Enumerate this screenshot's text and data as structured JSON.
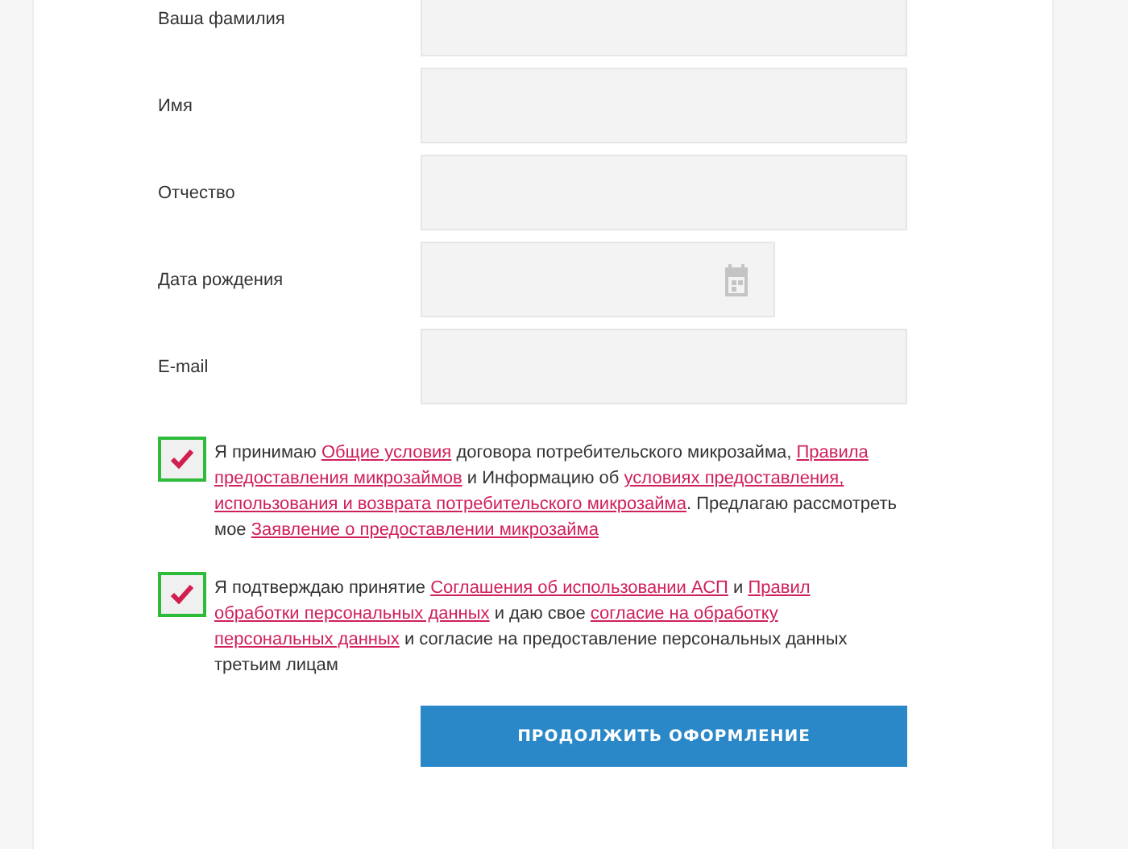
{
  "fields": [
    {
      "label": "Ваша фамилия",
      "kind": "text"
    },
    {
      "label": "Имя",
      "kind": "text"
    },
    {
      "label": "Отчество",
      "kind": "text"
    },
    {
      "label": "Дата рождения",
      "kind": "date"
    },
    {
      "label": "E-mail",
      "kind": "text"
    }
  ],
  "agreements": [
    {
      "checked": true,
      "parts": [
        {
          "text": "Я принимаю ",
          "kind": "text"
        },
        {
          "text": "Общие условия",
          "kind": "link"
        },
        {
          "text": " договора потребительского микрозайма, ",
          "kind": "text"
        },
        {
          "text": "Правила",
          "kind": "link"
        },
        {
          "text": "предоставления микрозаймов",
          "kind": "link"
        },
        {
          "text": " и Информацию об ",
          "kind": "text"
        },
        {
          "text": "условиях предоставления,",
          "kind": "link"
        },
        {
          "text": "использования и возврата потребительского микрозайма",
          "kind": "link"
        },
        {
          "text": ". Предлагаю рассмотреть мое ",
          "kind": "text"
        },
        {
          "text": "Заявление о предоставлении микрозайма",
          "kind": "link"
        }
      ]
    },
    {
      "checked": true,
      "parts": [
        {
          "text": "Я подтверждаю принятие ",
          "kind": "text"
        },
        {
          "text": "Соглашения об использовании АСП",
          "kind": "link"
        },
        {
          "text": " и ",
          "kind": "text"
        },
        {
          "text": "Правил",
          "kind": "link"
        },
        {
          "text": "обработки персональных данных",
          "kind": "link"
        },
        {
          "text": " и даю свое ",
          "kind": "text"
        },
        {
          "text": "согласие на обработку",
          "kind": "link"
        },
        {
          "text": "персональных данных",
          "kind": "link"
        },
        {
          "text": " и согласие на предоставление персональных данных третьим лицам",
          "kind": "text"
        }
      ]
    }
  ],
  "submit": "ПРОДОЛЖИТЬ ОФОРМЛЕНИЕ"
}
